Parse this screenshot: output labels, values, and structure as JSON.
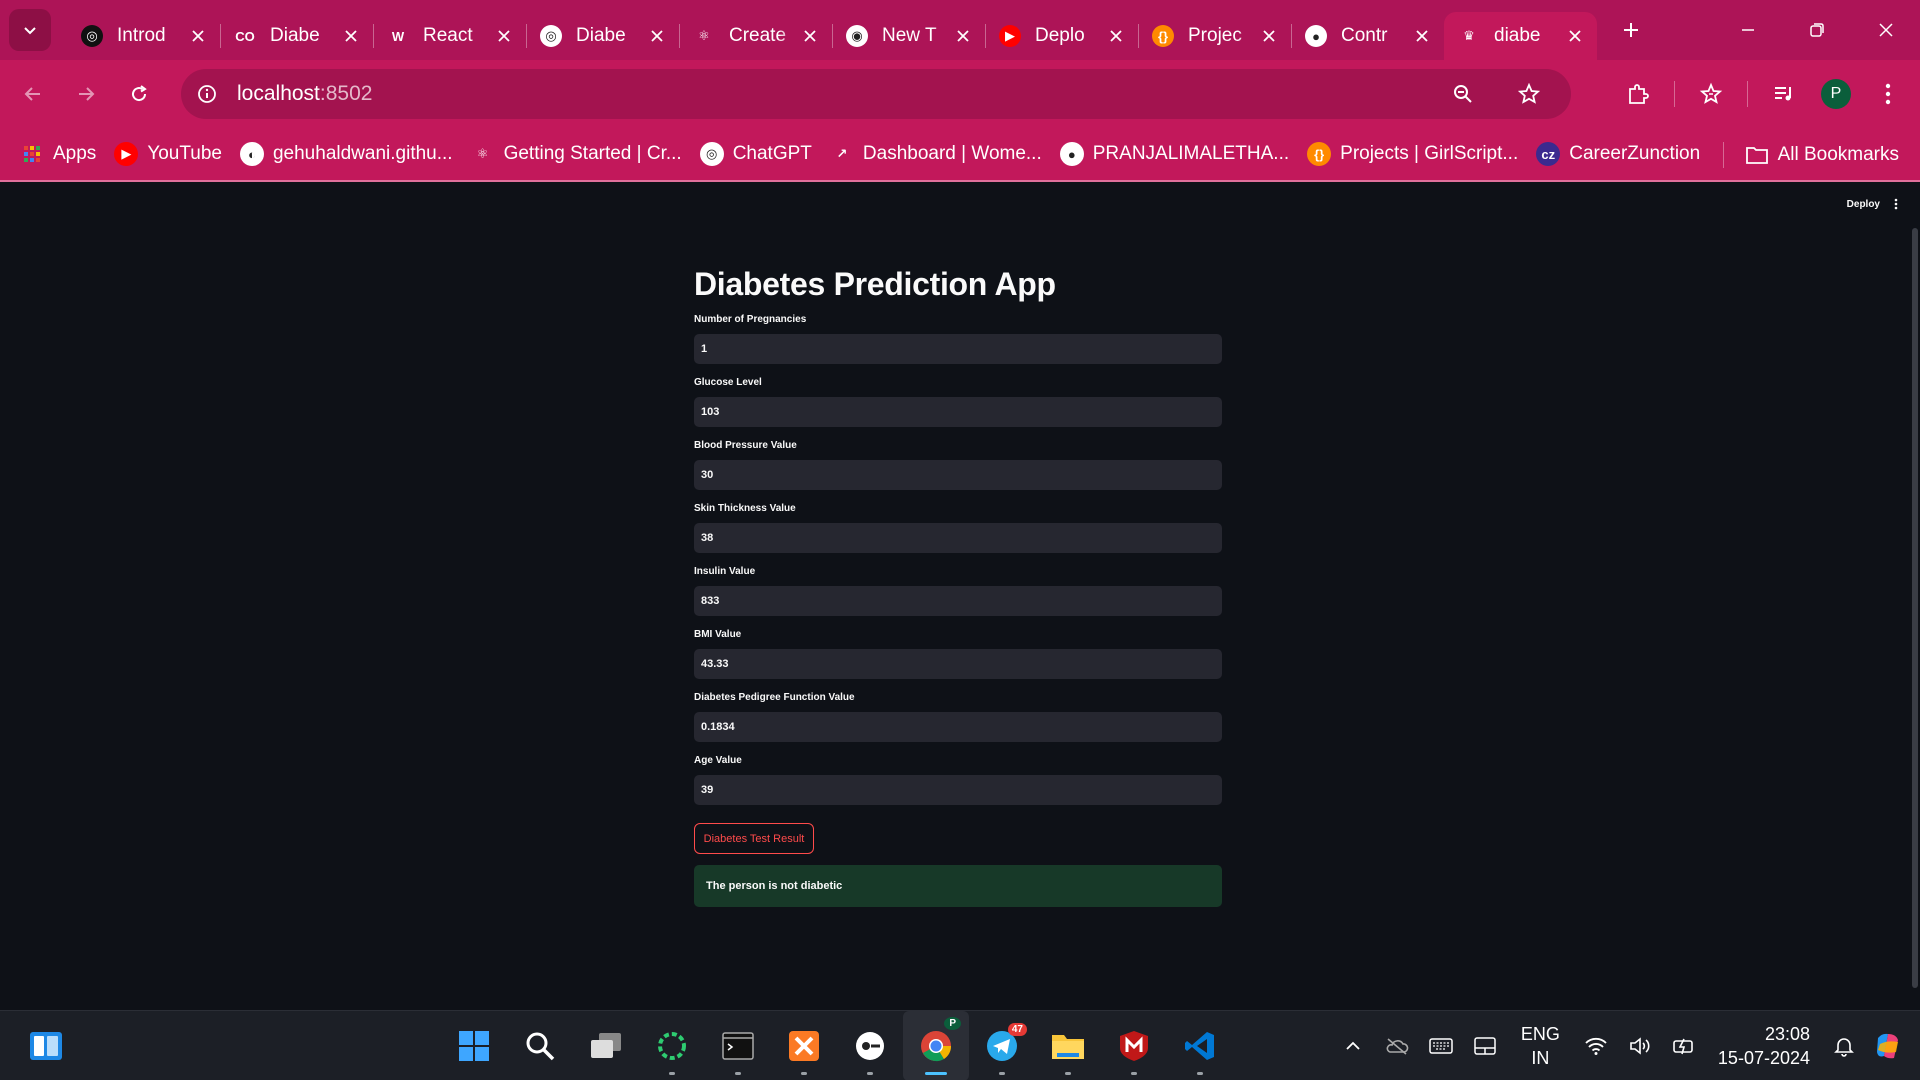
{
  "browser": {
    "tabs": [
      {
        "title": "Introd",
        "icon": "openai-icon",
        "fav_bg": "#111111",
        "fav_glyph": "◎"
      },
      {
        "title": "Diabe",
        "icon": "colab-icon",
        "fav_bg": "transparent",
        "fav_glyph": "CO"
      },
      {
        "title": "React",
        "icon": "w3-icon",
        "fav_bg": "transparent",
        "fav_glyph": "W"
      },
      {
        "title": "Diabe",
        "icon": "openai-icon",
        "fav_bg": "#ffffff",
        "fav_glyph": "◎"
      },
      {
        "title": "Create",
        "icon": "react-icon",
        "fav_bg": "transparent",
        "fav_glyph": "⚛"
      },
      {
        "title": "New T",
        "icon": "chrome-icon",
        "fav_bg": "#ffffff",
        "fav_glyph": "◉"
      },
      {
        "title": "Deplo",
        "icon": "youtube-icon",
        "fav_bg": "#ff0000",
        "fav_glyph": "▶"
      },
      {
        "title": "Projec",
        "icon": "girlscript-icon",
        "fav_bg": "#ff8a00",
        "fav_glyph": "{}"
      },
      {
        "title": "Contr",
        "icon": "github-icon",
        "fav_bg": "#ffffff",
        "fav_glyph": "●"
      },
      {
        "title": "diabe",
        "icon": "streamlit-icon",
        "fav_bg": "transparent",
        "fav_glyph": "♛",
        "active": true
      }
    ],
    "url_host": "localhost",
    "url_port": ":8502",
    "bookmarks": [
      {
        "label": "Apps",
        "icon": "apps-grid-icon",
        "bg": "transparent",
        "glyph": "⋮⋮"
      },
      {
        "label": "YouTube",
        "icon": "youtube-icon",
        "bg": "#ff0000",
        "glyph": "▶"
      },
      {
        "label": "gehuhaldwani.githu...",
        "icon": "gehu-icon",
        "bg": "#ffffff",
        "glyph": "◐"
      },
      {
        "label": "Getting Started | Cr...",
        "icon": "react-icon",
        "bg": "transparent",
        "glyph": "⚛"
      },
      {
        "label": "ChatGPT",
        "icon": "openai-icon",
        "bg": "#ffffff",
        "glyph": "◎"
      },
      {
        "label": "Dashboard | Wome...",
        "icon": "dashboard-icon",
        "bg": "transparent",
        "glyph": "↗"
      },
      {
        "label": "PRANJALIMALETHA...",
        "icon": "github-icon",
        "bg": "#ffffff",
        "glyph": "●"
      },
      {
        "label": "Projects | GirlScript...",
        "icon": "girlscript-icon",
        "bg": "#ff8a00",
        "glyph": "{}"
      },
      {
        "label": "CareerZunction",
        "icon": "careerzunction-icon",
        "bg": "#3b2a8f",
        "glyph": "cz"
      }
    ],
    "all_bookmarks": "All Bookmarks",
    "avatar_letter": "P"
  },
  "app": {
    "deploy_label": "Deploy",
    "title": "Diabetes Prediction App",
    "fields": [
      {
        "label": "Number of Pregnancies",
        "value": "1"
      },
      {
        "label": "Glucose Level",
        "value": "103"
      },
      {
        "label": "Blood Pressure Value",
        "value": "30"
      },
      {
        "label": "Skin Thickness Value",
        "value": "38"
      },
      {
        "label": "Insulin Value",
        "value": "833"
      },
      {
        "label": "BMI Value",
        "value": "43.33"
      },
      {
        "label": "Diabetes Pedigree Function Value",
        "value": "0.1834"
      },
      {
        "label": "Age Value",
        "value": "39"
      }
    ],
    "button_label": "Diabetes Test Result",
    "result_text": "The person is not diabetic",
    "colors": {
      "accent": "#ff4b4b",
      "success_bg": "#173928",
      "input_bg": "#262730",
      "app_bg": "#0e1117",
      "chrome": "#c2185b"
    }
  },
  "taskbar": {
    "apps": [
      "start-icon",
      "search-icon",
      "task-view-icon",
      "loader-app-icon",
      "terminal-icon",
      "xampp-icon",
      "chrome-remote-icon",
      "chrome-icon",
      "telegram-icon",
      "file-explorer-icon",
      "mcafee-icon",
      "vscode-icon"
    ],
    "telegram_badge": "47",
    "chrome_badge": "P",
    "lang_1": "ENG",
    "lang_2": "IN",
    "time": "23:08",
    "date": "15-07-2024"
  }
}
